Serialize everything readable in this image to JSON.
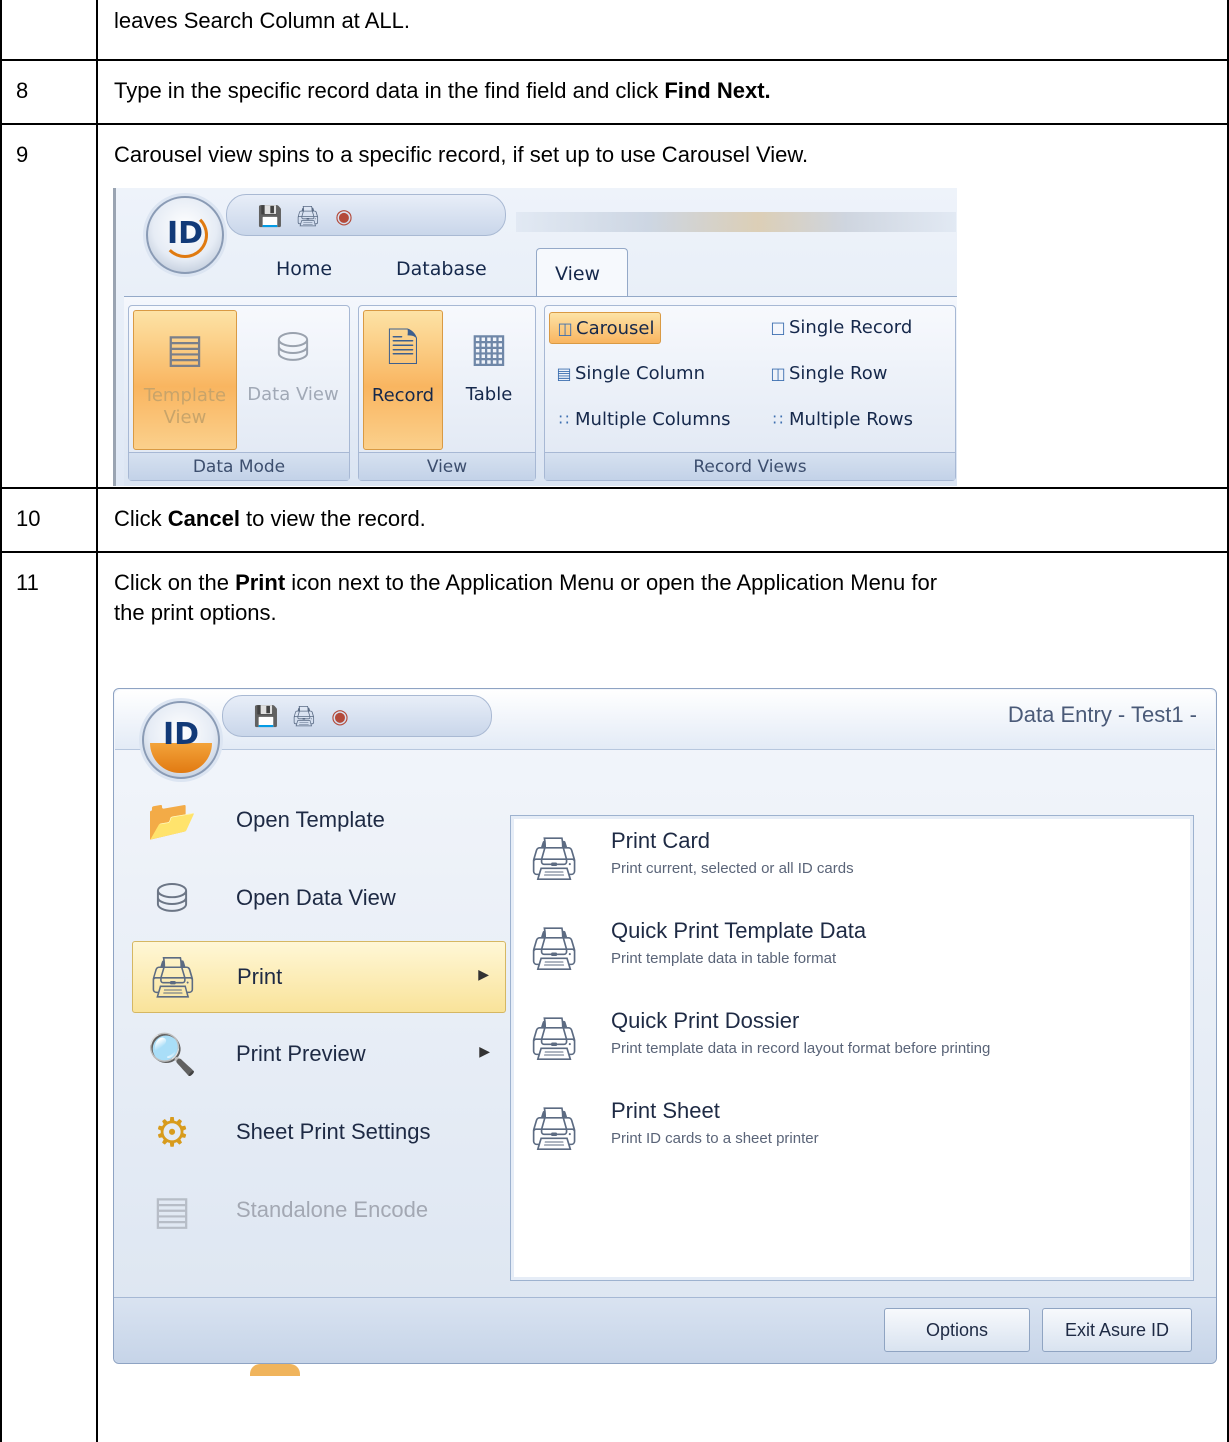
{
  "rows": [
    {
      "number": "",
      "text": "leaves Search Column at ALL."
    },
    {
      "number": "8",
      "text_before": "Type in the specific record data in the find field and click ",
      "bold": "Find Next.",
      "text_after": ""
    },
    {
      "number": "9",
      "text": "Carousel view spins to a specific record, if set up to use Carousel View."
    },
    {
      "number": "10",
      "text_before": "Click ",
      "bold": "Cancel",
      "text_after": " to view the record."
    },
    {
      "number": "11",
      "text_before": "Click on the ",
      "bold": "Print",
      "text_after": " icon next to the Application Menu or open the Application Menu for",
      "text_line2": "the print options."
    }
  ],
  "ribbon": {
    "orb_label": "ID",
    "tabs": [
      "Home",
      "Database",
      "View"
    ],
    "active_tab": "View",
    "groups": {
      "data_mode": {
        "label": "Data Mode",
        "buttons": [
          "Template View",
          "Data View"
        ]
      },
      "view": {
        "label": "View",
        "buttons": [
          "Record",
          "Table"
        ]
      },
      "record_views": {
        "label": "Record Views",
        "items": [
          "Carousel",
          "Single Record",
          "Single Column",
          "Single Row",
          "Multiple Columns",
          "Multiple Rows"
        ],
        "selected": "Carousel"
      }
    }
  },
  "app_menu": {
    "window_title": "Data Entry - Test1 -",
    "left_items": [
      "Open Template",
      "Open Data View",
      "Print",
      "Print Preview",
      "Sheet Print Settings",
      "Standalone Encode"
    ],
    "selected_left": "Print",
    "right_items": [
      {
        "title": "Print Card",
        "desc": "Print current, selected or all ID cards"
      },
      {
        "title": "Quick Print Template Data",
        "desc": "Print template data in table format"
      },
      {
        "title": "Quick Print Dossier",
        "desc": "Print template data in record layout format before printing"
      },
      {
        "title": "Print Sheet",
        "desc": "Print ID cards to a sheet printer"
      }
    ],
    "footer_buttons": [
      "Options",
      "Exit Asure ID"
    ]
  },
  "icons": [
    "save-icon",
    "print-icon",
    "database-icon",
    "template-icon",
    "record-icon",
    "table-icon",
    "printer-icon",
    "open-template-icon",
    "open-data-view-icon",
    "print-preview-icon",
    "sheet-settings-icon",
    "encode-icon"
  ],
  "colors": {
    "selection_orange": "#f9b560",
    "menu_highlight": "#f9e39a",
    "ribbon_blue": "#dae4f2"
  }
}
